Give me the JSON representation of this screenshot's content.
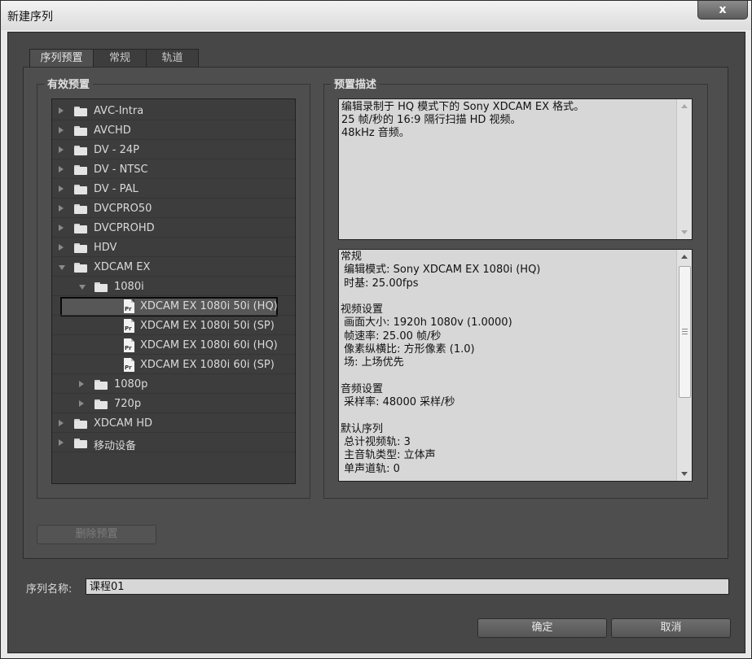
{
  "window": {
    "title": "新建序列",
    "close_label": "x"
  },
  "tabs": [
    {
      "label": "序列预置",
      "active": true
    },
    {
      "label": "常规",
      "active": false
    },
    {
      "label": "轨道",
      "active": false
    }
  ],
  "presets_group": {
    "title": "有效预置"
  },
  "tree": {
    "items": [
      {
        "label": "AVC-Intra",
        "level": 0,
        "type": "folder",
        "expanded": false
      },
      {
        "label": "AVCHD",
        "level": 0,
        "type": "folder",
        "expanded": false
      },
      {
        "label": "DV - 24P",
        "level": 0,
        "type": "folder",
        "expanded": false
      },
      {
        "label": "DV - NTSC",
        "level": 0,
        "type": "folder",
        "expanded": false
      },
      {
        "label": "DV - PAL",
        "level": 0,
        "type": "folder",
        "expanded": false
      },
      {
        "label": "DVCPRO50",
        "level": 0,
        "type": "folder",
        "expanded": false
      },
      {
        "label": "DVCPROHD",
        "level": 0,
        "type": "folder",
        "expanded": false
      },
      {
        "label": "HDV",
        "level": 0,
        "type": "folder",
        "expanded": false
      },
      {
        "label": "XDCAM EX",
        "level": 0,
        "type": "folder",
        "expanded": true
      },
      {
        "label": "1080i",
        "level": 1,
        "type": "folder",
        "expanded": true
      },
      {
        "label": "XDCAM EX 1080i 50i (HQ)",
        "level": 2,
        "type": "file",
        "selected": true
      },
      {
        "label": "XDCAM EX 1080i 50i (SP)",
        "level": 2,
        "type": "file"
      },
      {
        "label": "XDCAM EX 1080i 60i (HQ)",
        "level": 2,
        "type": "file"
      },
      {
        "label": "XDCAM EX 1080i 60i (SP)",
        "level": 2,
        "type": "file"
      },
      {
        "label": "1080p",
        "level": 1,
        "type": "folder",
        "expanded": false
      },
      {
        "label": "720p",
        "level": 1,
        "type": "folder",
        "expanded": false
      },
      {
        "label": "XDCAM HD",
        "level": 0,
        "type": "folder",
        "expanded": false
      },
      {
        "label": "移动设备",
        "level": 0,
        "type": "folder",
        "expanded": false
      }
    ],
    "file_icon_text": "Pr"
  },
  "description_group": {
    "title": "预置描述",
    "description_lines": [
      "编辑录制于 HQ 模式下的 Sony XDCAM EX 格式。",
      "25 帧/秒的 16:9 隔行扫描 HD 视频。",
      "48kHz 音频。"
    ]
  },
  "details": {
    "lines": [
      "常规",
      " 编辑模式: Sony XDCAM EX 1080i (HQ)",
      " 时基: 25.00fps",
      "",
      "视频设置",
      " 画面大小: 1920h 1080v (1.0000)",
      " 帧速率: 25.00 帧/秒",
      " 像素纵横比: 方形像素 (1.0)",
      " 场: 上场优先",
      "",
      "音频设置",
      " 采样率: 48000 采样/秒",
      "",
      "默认序列",
      " 总计视频轨: 3",
      " 主音轨类型: 立体声",
      " 单声道轨: 0"
    ]
  },
  "buttons": {
    "delete_preset": "删除预置",
    "ok": "确定",
    "cancel": "取消"
  },
  "sequence_name": {
    "label": "序列名称:",
    "value": "课程01"
  }
}
